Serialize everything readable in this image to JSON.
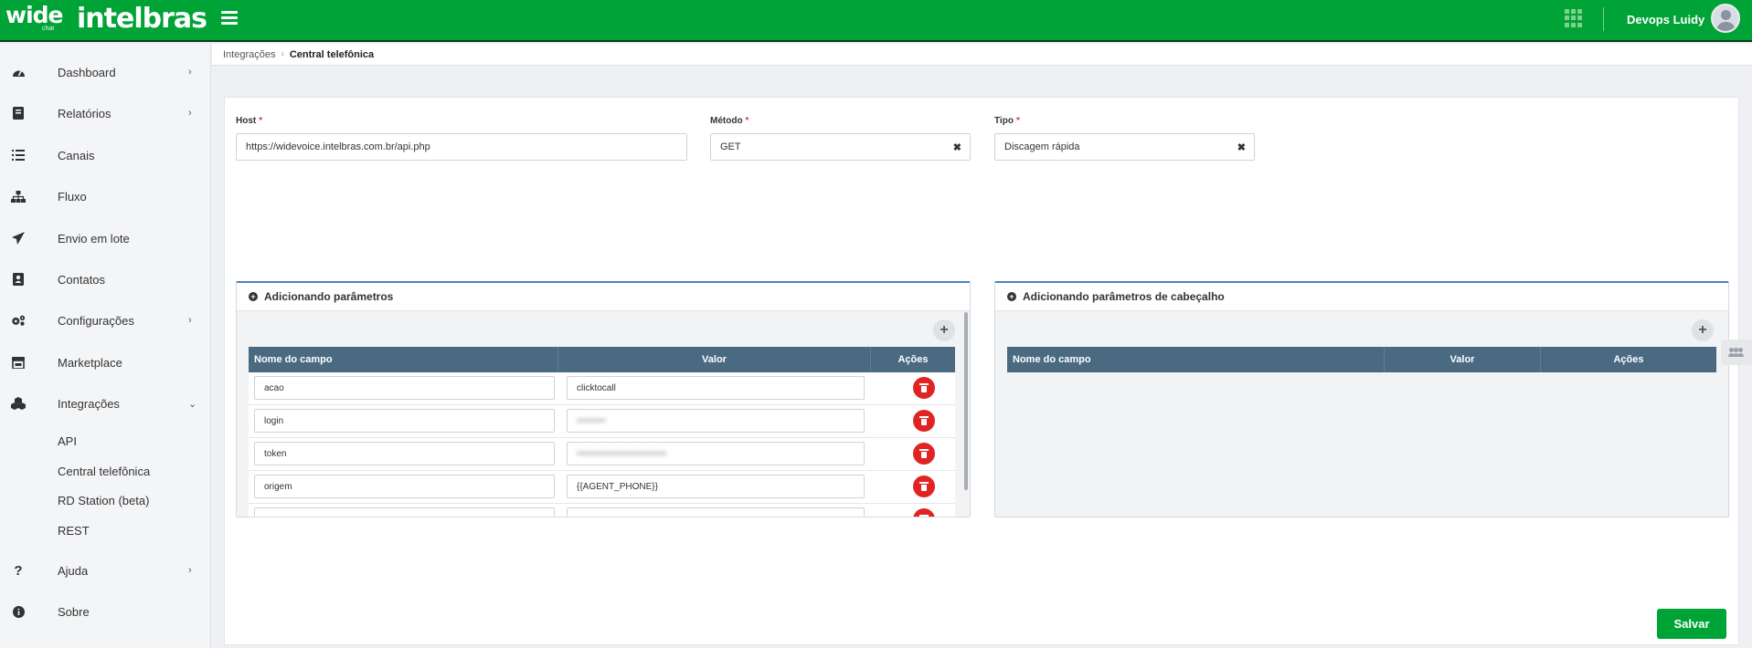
{
  "brand": {
    "logo_wide": "wide",
    "logo_wide_sub": "chat",
    "logo_partner": "intelbras"
  },
  "user": {
    "name": "Devops Luidy"
  },
  "sidebar": {
    "items": [
      {
        "label": "Dashboard"
      },
      {
        "label": "Relatórios"
      },
      {
        "label": "Canais"
      },
      {
        "label": "Fluxo"
      },
      {
        "label": "Envio em lote"
      },
      {
        "label": "Contatos"
      },
      {
        "label": "Configurações"
      },
      {
        "label": "Marketplace"
      },
      {
        "label": "Integrações"
      },
      {
        "label": "Ajuda"
      },
      {
        "label": "Sobre"
      }
    ],
    "integrations_sub": [
      {
        "label": "API"
      },
      {
        "label": "Central telefônica"
      },
      {
        "label": "RD Station (beta)"
      },
      {
        "label": "REST"
      }
    ]
  },
  "breadcrumb": {
    "parent": "Integrações",
    "current": "Central telefônica"
  },
  "form": {
    "host_label": "Host",
    "host_value": "https://widevoice.intelbras.com.br/api.php",
    "method_label": "Método",
    "method_value": "GET",
    "type_label": "Tipo",
    "type_value": "Discagem rápida",
    "required_mark": "*",
    "clear_glyph": "✖"
  },
  "params_panel": {
    "title": "Adicionando parâmetros",
    "columns": [
      "Nome do campo",
      "Valor",
      "Ações"
    ],
    "rows": [
      {
        "name": "acao",
        "value": "clicktocall"
      },
      {
        "name": "login",
        "value": "•••••••••"
      },
      {
        "name": "token",
        "value": "••••••••••••••••••••••••••••"
      },
      {
        "name": "origem",
        "value": "{{AGENT_PHONE}}"
      }
    ]
  },
  "header_params_panel": {
    "title": "Adicionando parâmetros de cabeçalho",
    "columns": [
      "Nome do campo",
      "Valor",
      "Ações"
    ]
  },
  "actions": {
    "add_glyph": "+",
    "save_label": "Salvar"
  },
  "colors": {
    "brand_green": "#00a335",
    "table_header": "#4a6a82",
    "delete_red": "#e02424",
    "panel_accent": "#4b84c4"
  }
}
